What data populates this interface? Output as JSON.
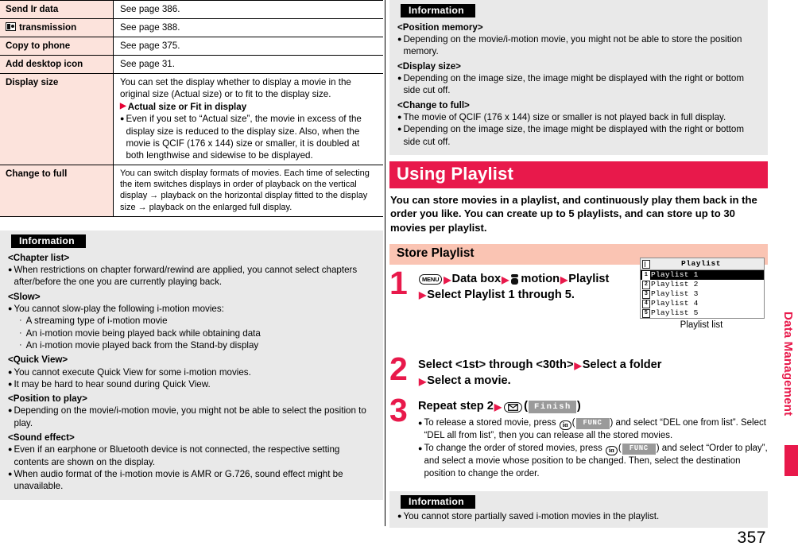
{
  "page_number": "357",
  "side_tab": {
    "label": "Data Management"
  },
  "left_column": {
    "spec_table": {
      "rows": [
        {
          "term": "Send Ir data",
          "icon": null,
          "desc": "See page 386."
        },
        {
          "term": "transmission",
          "icon": "ic-card-icon",
          "desc": "See page 388."
        },
        {
          "term": "Copy to phone",
          "icon": null,
          "desc": "See page 375."
        },
        {
          "term": "Add desktop icon",
          "icon": null,
          "desc": "See page 31."
        },
        {
          "term": "Display size",
          "icon": null,
          "desc": "You can set the display whether to display a movie in the original size (Actual size) or to fit to the display size.",
          "sub_head": "Actual size or Fit in display",
          "bullets": [
            "Even if you set to “Actual size”, the movie in excess of the display size is reduced to the display size. Also, when the movie is QCIF (176 x 144) size or smaller, it is doubled at both lengthwise and sidewise to be displayed."
          ]
        },
        {
          "term": "Change to full",
          "icon": null,
          "desc": "You can switch display formats of movies. Each time of selecting the item switches displays in order of playback on the vertical display → playback on the horizontal display fitted to the display size → playback on the enlarged full display."
        }
      ]
    },
    "information": {
      "tag": "Information",
      "groups": [
        {
          "heading": "<Chapter list>",
          "bullets": [
            "When restrictions on chapter forward/rewind are applied, you cannot select chapters after/before the one you are currently playing back."
          ],
          "subitems": []
        },
        {
          "heading": "<Slow>",
          "bullets": [
            "You cannot slow-play the following i-motion movies:"
          ],
          "subitems": [
            "A streaming type of i-motion movie",
            "An i-motion movie being played back while obtaining data",
            "An i-motion movie played back from the Stand-by display"
          ]
        },
        {
          "heading": "<Quick View>",
          "bullets": [
            "You cannot execute Quick View for some i-motion movies.",
            "It may be hard to hear sound during Quick View."
          ],
          "subitems": []
        },
        {
          "heading": "<Position to play>",
          "bullets": [
            "Depending on the movie/i-motion movie, you might not be able to select the position to play."
          ],
          "subitems": []
        },
        {
          "heading": "<Sound effect>",
          "bullets": [
            "Even if an earphone or Bluetooth device is not connected, the respective setting contents are shown on the display.",
            "When audio format of the i-motion movie is AMR or G.726, sound effect might be unavailable."
          ],
          "subitems": []
        }
      ]
    }
  },
  "right_column": {
    "information_top": {
      "tag": "Information",
      "groups": [
        {
          "heading": "<Position memory>",
          "bullets": [
            "Depending on the movie/i-motion movie, you might not be able to store the position memory."
          ]
        },
        {
          "heading": "<Display size>",
          "bullets": [
            "Depending on the image size, the image might be displayed with the right or bottom side cut off."
          ]
        },
        {
          "heading": "<Change to full>",
          "bullets": [
            "The movie of QCIF (176 x 144) size or smaller is not played back in full display.",
            "Depending on the image size, the image might be displayed with the right or bottom side cut off."
          ]
        }
      ]
    },
    "section": {
      "title": "Using Playlist",
      "lead": "You can store movies in a playlist, and continuously play them back in the order you like. You can create up to 5 playlists, and can store up to 30 movies per playlist.",
      "subsection_title": "Store Playlist"
    },
    "steps": [
      {
        "number": "1",
        "line1_parts": [
          "MENU",
          "Data box",
          "motion",
          "Playlist"
        ],
        "menu_key_label": "MENU",
        "text_data_box": "Data box",
        "text_motion": "motion",
        "text_playlist": "Playlist",
        "line2": "Select Playlist 1 through 5."
      },
      {
        "number": "2",
        "line1": "Select <1st> through <30th>",
        "line1b": "Select a folder",
        "line2": "Select a movie."
      },
      {
        "number": "3",
        "line1": "Repeat step 2",
        "key_label": "Finish",
        "bullets": [
          {
            "pre": "To release a stored movie, press",
            "key": "FUNC",
            "post": ") and select “DEL one from list”. Select “DEL all from list”, then you can release all the stored movies."
          },
          {
            "pre": "To change the order of stored movies, press",
            "key": "FUNC",
            "post": ") and select “Order to play”, and select a movie whose position to be changed. Then, select the destination position to change the order."
          }
        ]
      }
    ],
    "phone_mock": {
      "screen_title": "Playlist",
      "items": [
        {
          "num": "1",
          "label": "Playlist 1",
          "selected": true
        },
        {
          "num": "2",
          "label": "Playlist 2",
          "selected": false
        },
        {
          "num": "3",
          "label": "Playlist 3",
          "selected": false
        },
        {
          "num": "4",
          "label": "Playlist 4",
          "selected": false
        },
        {
          "num": "5",
          "label": "Playlist 5",
          "selected": false
        }
      ],
      "caption": "Playlist list"
    },
    "information_bottom": {
      "tag": "Information",
      "bullets": [
        "You cannot store partially saved i-motion movies in the playlist."
      ]
    }
  },
  "colors": {
    "accent_red": "#e8194b",
    "table_term_bg": "#fce3dc",
    "subsection_bg": "#fac4b3",
    "info_bg": "#e9e9e9"
  }
}
